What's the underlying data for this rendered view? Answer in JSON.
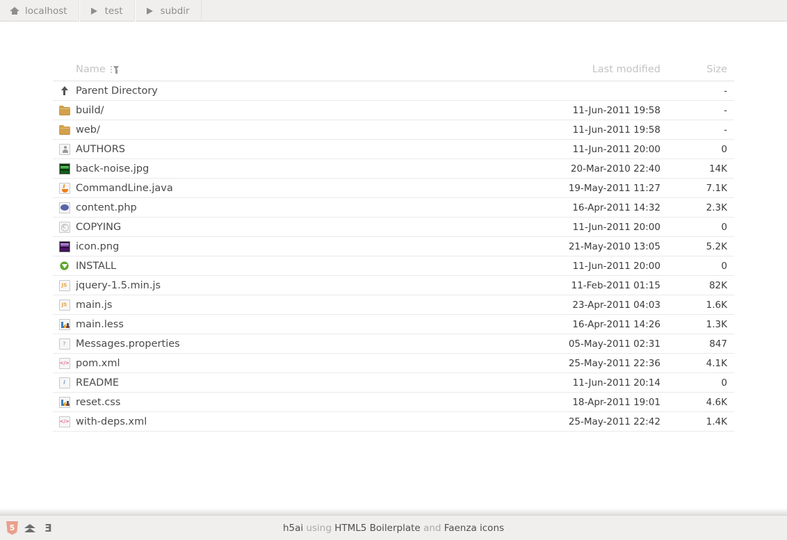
{
  "breadcrumb": [
    {
      "label": "localhost",
      "icon": "home-icon"
    },
    {
      "label": "test",
      "icon": "triangle-right-icon"
    },
    {
      "label": "subdir",
      "icon": "triangle-right-icon"
    }
  ],
  "table": {
    "headers": {
      "name": "Name",
      "last_modified": "Last modified",
      "size": "Size"
    },
    "sort": {
      "column": "Name",
      "direction": "descending",
      "icon": "sort-descending-icon"
    },
    "rows": [
      {
        "name": "Parent Directory",
        "date": "",
        "size": "-",
        "icon": "parent-directory-arrow-icon"
      },
      {
        "name": "build/",
        "date": "11-Jun-2011 19:58",
        "size": "-",
        "icon": "folder-icon"
      },
      {
        "name": "web/",
        "date": "11-Jun-2011 19:58",
        "size": "-",
        "icon": "folder-icon"
      },
      {
        "name": "AUTHORS",
        "date": "11-Jun-2011 20:00",
        "size": "0",
        "icon": "authors-person-icon"
      },
      {
        "name": "back-noise.jpg",
        "date": "20-Mar-2010 22:40",
        "size": "14K",
        "icon": "image-jpg-icon"
      },
      {
        "name": "CommandLine.java",
        "date": "19-May-2011 11:27",
        "size": "7.1K",
        "icon": "java-icon"
      },
      {
        "name": "content.php",
        "date": "16-Apr-2011 14:32",
        "size": "2.3K",
        "icon": "php-icon"
      },
      {
        "name": "COPYING",
        "date": "11-Jun-2011 20:00",
        "size": "0",
        "icon": "copyright-icon"
      },
      {
        "name": "icon.png",
        "date": "21-May-2010 13:05",
        "size": "5.2K",
        "icon": "image-png-icon"
      },
      {
        "name": "INSTALL",
        "date": "11-Jun-2011 20:00",
        "size": "0",
        "icon": "install-icon"
      },
      {
        "name": "jquery-1.5.min.js",
        "date": "11-Feb-2011 01:15",
        "size": "82K",
        "icon": "javascript-icon",
        "badge": "JS"
      },
      {
        "name": "main.js",
        "date": "23-Apr-2011 04:03",
        "size": "1.6K",
        "icon": "javascript-icon",
        "badge": "JS"
      },
      {
        "name": "main.less",
        "date": "16-Apr-2011 14:26",
        "size": "1.3K",
        "icon": "stylesheet-icon"
      },
      {
        "name": "Messages.properties",
        "date": "05-May-2011 02:31",
        "size": "847",
        "icon": "unknown-file-icon",
        "badge": "?"
      },
      {
        "name": "pom.xml",
        "date": "25-May-2011 22:36",
        "size": "4.1K",
        "icon": "xml-icon",
        "badge": "</>"
      },
      {
        "name": "README",
        "date": "11-Jun-2011 20:14",
        "size": "0",
        "icon": "info-icon",
        "badge": "i"
      },
      {
        "name": "reset.css",
        "date": "18-Apr-2011 19:01",
        "size": "4.6K",
        "icon": "stylesheet-icon"
      },
      {
        "name": "with-deps.xml",
        "date": "25-May-2011 22:42",
        "size": "1.4K",
        "icon": "xml-icon",
        "badge": "</>"
      }
    ]
  },
  "footer": {
    "logos": [
      {
        "name": "html5-logo",
        "glyph": "5"
      },
      {
        "name": "html5-boilerplate-logo",
        "glyph": ""
      },
      {
        "name": "less-css-logo",
        "glyph": "E"
      }
    ],
    "text_parts": [
      {
        "text": "h5ai",
        "muted": false
      },
      {
        "text": " using ",
        "muted": true
      },
      {
        "text": "HTML5 Boilerplate",
        "muted": false
      },
      {
        "text": " and ",
        "muted": true
      },
      {
        "text": "Faenza icons",
        "muted": false
      }
    ],
    "full_text": "h5ai using HTML5 Boilerplate and Faenza icons"
  },
  "colors": {
    "chrome_bg": "#f0efee",
    "page_bg": "#ffffff",
    "row_border": "#eaeaea",
    "header_text": "#c4c4c4",
    "folder": "#d3a04b",
    "breadcrumb_text": "#8d8d8d"
  }
}
